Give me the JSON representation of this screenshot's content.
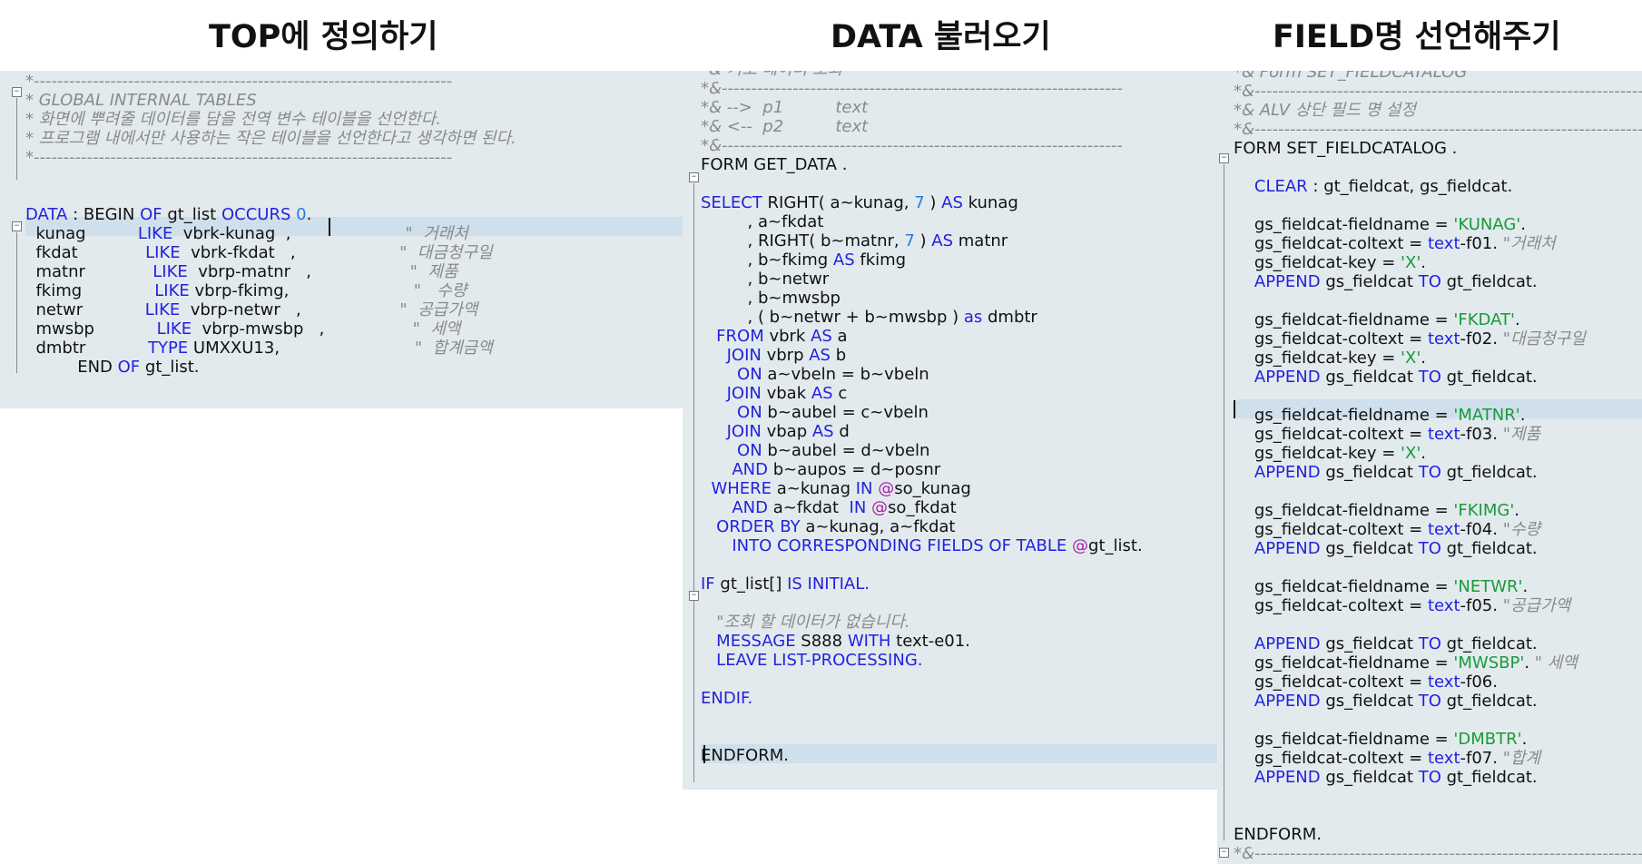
{
  "titles": {
    "left": "TOP에 정의하기",
    "middle": "DATA 불러오기",
    "right": "FIELD명 선언해주기"
  },
  "panel_left": {
    "lines": [
      [
        [
          "cm",
          "*-----------------------------------------------------------------------"
        ]
      ],
      [
        [
          "cm",
          "* GLOBAL INTERNAL TABLES"
        ]
      ],
      [
        [
          "cm",
          "* 화면에 뿌려줄 데이터를 담을 전역 변수 테이블을 선언한다."
        ]
      ],
      [
        [
          "cm",
          "* 프로그램 내에서만 사용하는 작은 테이블을 선언한다고 생각하면 된다."
        ]
      ],
      [
        [
          "cm",
          "*-----------------------------------------------------------------------"
        ]
      ],
      [],
      [],
      [
        [
          "kw",
          "DATA"
        ],
        [
          "tx",
          " : "
        ],
        [
          "tx",
          "BEGIN "
        ],
        [
          "kw",
          "OF "
        ],
        [
          "tx",
          "gt_list "
        ],
        [
          "kw",
          "OCCURS "
        ],
        [
          "nm",
          "0"
        ],
        [
          "tx",
          "."
        ]
      ],
      [
        [
          "tx",
          "  kunag          "
        ],
        [
          "kw",
          "LIKE"
        ],
        [
          "tx",
          "  vbrk-kunag  ,"
        ],
        [
          "cm",
          "                      \"  거래처"
        ]
      ],
      [
        [
          "tx",
          "  fkdat             "
        ],
        [
          "kw",
          "LIKE"
        ],
        [
          "tx",
          "  vbrk-fkdat   ,"
        ],
        [
          "cm",
          "                    \"  대금청구일"
        ]
      ],
      [
        [
          "tx",
          "  matnr             "
        ],
        [
          "kw",
          "LIKE"
        ],
        [
          "tx",
          "  vbrp-matnr   ,"
        ],
        [
          "cm",
          "                   \"  제품"
        ]
      ],
      [
        [
          "tx",
          "  fkimg              "
        ],
        [
          "kw",
          "LIKE"
        ],
        [
          "tx",
          " vbrp-fkimg,"
        ],
        [
          "cm",
          "                        \"   수량"
        ]
      ],
      [
        [
          "tx",
          "  netwr            "
        ],
        [
          "kw",
          "LIKE"
        ],
        [
          "tx",
          "  vbrp-netwr   ,"
        ],
        [
          "cm",
          "                   \"  공급가액"
        ]
      ],
      [
        [
          "tx",
          "  mwsbp            "
        ],
        [
          "kw",
          "LIKE"
        ],
        [
          "tx",
          "  vbrp-mwsbp   ,"
        ],
        [
          "cm",
          "                 \"  세액"
        ]
      ],
      [
        [
          "tx",
          "  dmbtr            "
        ],
        [
          "kw",
          "TYPE"
        ],
        [
          "tx",
          " UMXXU13,"
        ],
        [
          "cm",
          "                          \"  합계금액"
        ]
      ],
      [
        [
          "tx",
          "          END "
        ],
        [
          "kw",
          "OF "
        ],
        [
          "tx",
          "gt_list."
        ]
      ]
    ]
  },
  "panel_middle": {
    "lines": [
      [
        [
          "cm",
          "*& 기초 데이터 조회"
        ]
      ],
      [
        [
          "cm",
          "*&--------------------------------------------------------------------"
        ]
      ],
      [
        [
          "cm",
          "*& -->  p1          text"
        ]
      ],
      [
        [
          "cm",
          "*& <--  p2          text"
        ]
      ],
      [
        [
          "cm",
          "*&--------------------------------------------------------------------"
        ]
      ],
      [
        [
          "tx",
          "FORM GET_DATA ."
        ]
      ],
      [],
      [
        [
          "kw",
          "SELECT "
        ],
        [
          "tx",
          "RIGHT( a~kunag, "
        ],
        [
          "nm",
          "7"
        ],
        [
          "tx",
          " ) "
        ],
        [
          "kw",
          "AS "
        ],
        [
          "tx",
          "kunag"
        ]
      ],
      [
        [
          "tx",
          "         , a~fkdat"
        ]
      ],
      [
        [
          "tx",
          "         , RIGHT( b~matnr, "
        ],
        [
          "nm",
          "7"
        ],
        [
          "tx",
          " ) "
        ],
        [
          "kw",
          "AS "
        ],
        [
          "tx",
          "matnr"
        ]
      ],
      [
        [
          "tx",
          "         , b~fkimg "
        ],
        [
          "kw",
          "AS "
        ],
        [
          "tx",
          "fkimg"
        ]
      ],
      [
        [
          "tx",
          "         , b~netwr"
        ]
      ],
      [
        [
          "tx",
          "         , b~mwsbp"
        ]
      ],
      [
        [
          "tx",
          "         , ( b~netwr + b~mwsbp ) "
        ],
        [
          "kw",
          "as "
        ],
        [
          "tx",
          "dmbtr"
        ]
      ],
      [
        [
          "kw",
          "   FROM "
        ],
        [
          "tx",
          "vbrk "
        ],
        [
          "kw",
          "AS "
        ],
        [
          "tx",
          "a"
        ]
      ],
      [
        [
          "kw",
          "     JOIN "
        ],
        [
          "tx",
          "vbrp "
        ],
        [
          "kw",
          "AS "
        ],
        [
          "tx",
          "b"
        ]
      ],
      [
        [
          "kw",
          "       ON "
        ],
        [
          "tx",
          "a~vbeln = b~vbeln"
        ]
      ],
      [
        [
          "kw",
          "     JOIN "
        ],
        [
          "tx",
          "vbak "
        ],
        [
          "kw",
          "AS "
        ],
        [
          "tx",
          "c"
        ]
      ],
      [
        [
          "kw",
          "       ON "
        ],
        [
          "tx",
          "b~aubel = c~vbeln"
        ]
      ],
      [
        [
          "kw",
          "     JOIN "
        ],
        [
          "tx",
          "vbap "
        ],
        [
          "kw",
          "AS "
        ],
        [
          "tx",
          "d"
        ]
      ],
      [
        [
          "kw",
          "       ON "
        ],
        [
          "tx",
          "b~aubel = d~vbeln"
        ]
      ],
      [
        [
          "kw",
          "      AND "
        ],
        [
          "tx",
          "b~aupos = d~posnr"
        ]
      ],
      [
        [
          "kw",
          "  WHERE "
        ],
        [
          "tx",
          "a~kunag "
        ],
        [
          "kw",
          "IN "
        ],
        [
          "at",
          "@"
        ],
        [
          "tx",
          "so_kunag"
        ]
      ],
      [
        [
          "kw",
          "      AND "
        ],
        [
          "tx",
          "a~fkdat  "
        ],
        [
          "kw",
          "IN "
        ],
        [
          "at",
          "@"
        ],
        [
          "tx",
          "so_fkdat"
        ]
      ],
      [
        [
          "kw",
          "   ORDER BY "
        ],
        [
          "tx",
          "a~kunag, a~fkdat"
        ]
      ],
      [
        [
          "kw",
          "      INTO CORRESPONDING FIELDS OF TABLE "
        ],
        [
          "at",
          "@"
        ],
        [
          "tx",
          "gt_list."
        ]
      ],
      [],
      [
        [
          "kw",
          "IF "
        ],
        [
          "tx",
          "gt_list[] "
        ],
        [
          "kw",
          "IS INITIAL."
        ]
      ],
      [],
      [
        [
          "cm",
          "   \"조회 할 데이터가 없습니다."
        ]
      ],
      [
        [
          "kw",
          "   MESSAGE "
        ],
        [
          "tx",
          "S888 "
        ],
        [
          "kw",
          "WITH "
        ],
        [
          "tx",
          "text-e01."
        ]
      ],
      [
        [
          "kw",
          "   LEAVE LIST-PROCESSING."
        ]
      ],
      [],
      [
        [
          "kw",
          "ENDIF."
        ]
      ],
      [],
      [],
      [
        [
          "tx",
          "ENDFORM."
        ]
      ]
    ]
  },
  "panel_right": {
    "lines": [
      [
        [
          "cm",
          "*& Form SET_FIELDCATALOG"
        ]
      ],
      [
        [
          "cm",
          "*&--------------------------------------------------------------------"
        ]
      ],
      [
        [
          "cm",
          "*& ALV 상단 필드 명 설정"
        ]
      ],
      [
        [
          "cm",
          "*&--------------------------------------------------------------------"
        ]
      ],
      [
        [
          "tx",
          "FORM SET_FIELDCATALOG ."
        ]
      ],
      [],
      [
        [
          "kw",
          "    CLEAR"
        ],
        [
          "tx",
          " : gt_fieldcat, gs_fieldcat."
        ]
      ],
      [],
      [
        [
          "tx",
          "    gs_fieldcat-fieldname = "
        ],
        [
          "st",
          "'KUNAG'"
        ],
        [
          "tx",
          "."
        ]
      ],
      [
        [
          "tx",
          "    gs_fieldcat-coltext = "
        ],
        [
          "kw",
          "text"
        ],
        [
          "tx",
          "-f01. "
        ],
        [
          "cm",
          "\"거래처"
        ]
      ],
      [
        [
          "tx",
          "    gs_fieldcat-key = "
        ],
        [
          "st",
          "'X'"
        ],
        [
          "tx",
          "."
        ]
      ],
      [
        [
          "kw",
          "    APPEND "
        ],
        [
          "tx",
          "gs_fieldcat "
        ],
        [
          "kw",
          "TO "
        ],
        [
          "tx",
          "gt_fieldcat."
        ]
      ],
      [],
      [
        [
          "tx",
          "    gs_fieldcat-fieldname = "
        ],
        [
          "st",
          "'FKDAT'"
        ],
        [
          "tx",
          "."
        ]
      ],
      [
        [
          "tx",
          "    gs_fieldcat-coltext = "
        ],
        [
          "kw",
          "text"
        ],
        [
          "tx",
          "-f02. "
        ],
        [
          "cm",
          "\"대금청구일"
        ]
      ],
      [
        [
          "tx",
          "    gs_fieldcat-key = "
        ],
        [
          "st",
          "'X'"
        ],
        [
          "tx",
          "."
        ]
      ],
      [
        [
          "kw",
          "    APPEND "
        ],
        [
          "tx",
          "gs_fieldcat "
        ],
        [
          "kw",
          "TO "
        ],
        [
          "tx",
          "gt_fieldcat."
        ]
      ],
      [],
      [
        [
          "tx",
          "    gs_fieldcat-fieldname = "
        ],
        [
          "st",
          "'MATNR'"
        ],
        [
          "tx",
          "."
        ]
      ],
      [
        [
          "tx",
          "    gs_fieldcat-coltext = "
        ],
        [
          "kw",
          "text"
        ],
        [
          "tx",
          "-f03. "
        ],
        [
          "cm",
          "\"제품"
        ]
      ],
      [
        [
          "tx",
          "    gs_fieldcat-key = "
        ],
        [
          "st",
          "'X'"
        ],
        [
          "tx",
          "."
        ]
      ],
      [
        [
          "kw",
          "    APPEND "
        ],
        [
          "tx",
          "gs_fieldcat "
        ],
        [
          "kw",
          "TO "
        ],
        [
          "tx",
          "gt_fieldcat."
        ]
      ],
      [],
      [
        [
          "tx",
          "    gs_fieldcat-fieldname = "
        ],
        [
          "st",
          "'FKIMG'"
        ],
        [
          "tx",
          "."
        ]
      ],
      [
        [
          "tx",
          "    gs_fieldcat-coltext = "
        ],
        [
          "kw",
          "text"
        ],
        [
          "tx",
          "-f04. "
        ],
        [
          "cm",
          "\"수량"
        ]
      ],
      [
        [
          "kw",
          "    APPEND "
        ],
        [
          "tx",
          "gs_fieldcat "
        ],
        [
          "kw",
          "TO "
        ],
        [
          "tx",
          "gt_fieldcat."
        ]
      ],
      [],
      [
        [
          "tx",
          "    gs_fieldcat-fieldname = "
        ],
        [
          "st",
          "'NETWR'"
        ],
        [
          "tx",
          "."
        ]
      ],
      [
        [
          "tx",
          "    gs_fieldcat-coltext = "
        ],
        [
          "kw",
          "text"
        ],
        [
          "tx",
          "-f05. "
        ],
        [
          "cm",
          "\"공급가액"
        ]
      ],
      [],
      [
        [
          "kw",
          "    APPEND "
        ],
        [
          "tx",
          "gs_fieldcat "
        ],
        [
          "kw",
          "TO "
        ],
        [
          "tx",
          "gt_fieldcat."
        ]
      ],
      [
        [
          "tx",
          "    gs_fieldcat-fieldname = "
        ],
        [
          "st",
          "'MWSBP'"
        ],
        [
          "tx",
          ". "
        ],
        [
          "cm",
          "\" 세액"
        ]
      ],
      [
        [
          "tx",
          "    gs_fieldcat-coltext = "
        ],
        [
          "kw",
          "text"
        ],
        [
          "tx",
          "-f06."
        ]
      ],
      [
        [
          "kw",
          "    APPEND "
        ],
        [
          "tx",
          "gs_fieldcat "
        ],
        [
          "kw",
          "TO "
        ],
        [
          "tx",
          "gt_fieldcat."
        ]
      ],
      [],
      [
        [
          "tx",
          "    gs_fieldcat-fieldname = "
        ],
        [
          "st",
          "'DMBTR'"
        ],
        [
          "tx",
          "."
        ]
      ],
      [
        [
          "tx",
          "    gs_fieldcat-coltext = "
        ],
        [
          "kw",
          "text"
        ],
        [
          "tx",
          "-f07. "
        ],
        [
          "cm",
          "\"합계"
        ]
      ],
      [
        [
          "kw",
          "    APPEND "
        ],
        [
          "tx",
          "gs_fieldcat "
        ],
        [
          "kw",
          "TO "
        ],
        [
          "tx",
          "gt_fieldcat."
        ]
      ],
      [],
      [],
      [
        [
          "tx",
          "ENDFORM."
        ]
      ],
      [
        [
          "cm",
          "*&--------------------------------------------------------------------"
        ]
      ]
    ]
  }
}
